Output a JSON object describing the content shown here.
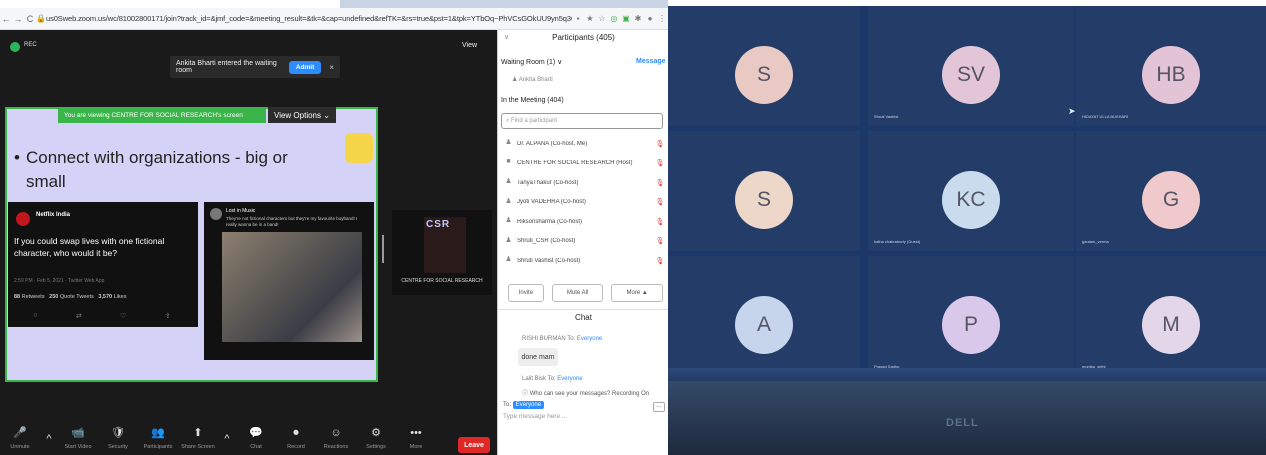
{
  "browser": {
    "url": "us0Sweb.zoom.us/wc/81002800171/join?track_id=&jmf_code=&meeting_result=&tk=&cap=undefined&refTK=&rs=true&pst=1&tpk=YTbOq~PhVCsGOkUU9yn5q3OXIPqSYzLDJ...",
    "back": "←",
    "forward": "→",
    "reload": "C",
    "lock": "🔒"
  },
  "zoom": {
    "rec_label": "REC",
    "view_label": "View",
    "waiting_notice": "Ankita Bharti entered the waiting room",
    "admit_label": "Admit",
    "close_label": "×",
    "viewing_bar": "You are viewing CENTRE FOR SOCIAL RESEARCH's screen",
    "view_options": "View Options",
    "slide_bullet": "Connect with organizations - big or small",
    "tweet1": {
      "author": "Netflix India",
      "text": "If you could swap lives with one fictional character, who would it be?",
      "meta": "2:59 PM · Feb 5, 2021 · Twitter Web App",
      "retweets": "88",
      "quotes": "250",
      "likes": "3,570"
    },
    "tweet2": {
      "author": "Lost in Music",
      "text": "They're not fictional characters but they're my favourite boyband! I really wanna be in a band!"
    },
    "thumb_name": "CENTRE FOR SOCIAL RESEARCH",
    "thumb_logo": "CSR",
    "toolbar": [
      {
        "icon": "🎤",
        "label": "Unmute",
        "name": "unmute-button"
      },
      {
        "icon": "^",
        "label": "",
        "name": "audio-options-button"
      },
      {
        "icon": "📹",
        "label": "Start Video",
        "name": "start-video-button"
      },
      {
        "icon": "🛡",
        "label": "Security",
        "name": "security-button"
      },
      {
        "icon": "👥",
        "label": "Participants",
        "name": "participants-button"
      },
      {
        "icon": "⬆",
        "label": "Share Screen",
        "name": "share-screen-button"
      },
      {
        "icon": "^",
        "label": "",
        "name": "share-options-button"
      },
      {
        "icon": "💬",
        "label": "Chat",
        "name": "chat-button"
      },
      {
        "icon": "⏺",
        "label": "Record",
        "name": "record-button"
      },
      {
        "icon": "☺",
        "label": "Reactions",
        "name": "reactions-button"
      },
      {
        "icon": "⚙",
        "label": "Settings",
        "name": "settings-button"
      },
      {
        "icon": "•••",
        "label": "More",
        "name": "more-button"
      }
    ],
    "leave_label": "Leave",
    "colors": {
      "accent": "#2d8cff",
      "share_green": "#3ab54a",
      "leave_red": "#e02828"
    }
  },
  "participants": {
    "title": "Participants (405)",
    "waiting_room": "Waiting Room (1) ∨",
    "message": "Message",
    "waiting_person": "Ankita Bharti",
    "in_meeting": "In the Meeting (404)",
    "search_placeholder": "Find a participant",
    "list": [
      {
        "name": "Dr. ALPANA (Co-host, Me)"
      },
      {
        "name": "CENTRE FOR SOCIAL RESEARCH (Host)"
      },
      {
        "name": "TanyaThakur (Co-host)"
      },
      {
        "name": "Jyoti VADEHRA (Co-host)"
      },
      {
        "name": "Riksonsharma (Co-host)"
      },
      {
        "name": "Shruti_CSR (Co-host)"
      },
      {
        "name": "Shruti Vashist (Co-host)"
      }
    ],
    "invite": "Invite",
    "mute_all": "Mute All",
    "more": "More ▲"
  },
  "chat": {
    "title": "Chat",
    "msg1_from": "RISHI BURMAN To:",
    "msg1_to": "Everyone",
    "msg1_text": "done mam",
    "msg2_from": "Lalit Bisk To:",
    "msg2_to": "Everyone",
    "warning": "Who can see your messages? Recording On",
    "to_label": "To:",
    "to_value": "Everyone",
    "placeholder": "Type message here ..."
  },
  "laptop_grid": {
    "tiles": [
      {
        "initials": "S",
        "name": "",
        "color": "#e9c9c3"
      },
      {
        "initials": "SV",
        "name": "Shruti Vashist",
        "color": "#e2c6d7"
      },
      {
        "initials": "HB",
        "name": "HIDAYAT ULLA BUKHARI",
        "color": "#e3c3d6"
      },
      {
        "initials": "S",
        "name": "",
        "color": "#ecd7c8"
      },
      {
        "initials": "KC",
        "name": "katha chakraborty (Guest)",
        "color": "#c8dced"
      },
      {
        "initials": "G",
        "name": "gautam_verma",
        "color": "#efc9cb"
      },
      {
        "initials": "A",
        "name": "",
        "color": "#c6d4ec"
      },
      {
        "initials": "P",
        "name": "Prasad Sadhu",
        "color": "#d9c8ea"
      },
      {
        "initials": "M",
        "name": "monika_sethi",
        "color": "#e3d6e8"
      }
    ],
    "brand": "DELL"
  }
}
